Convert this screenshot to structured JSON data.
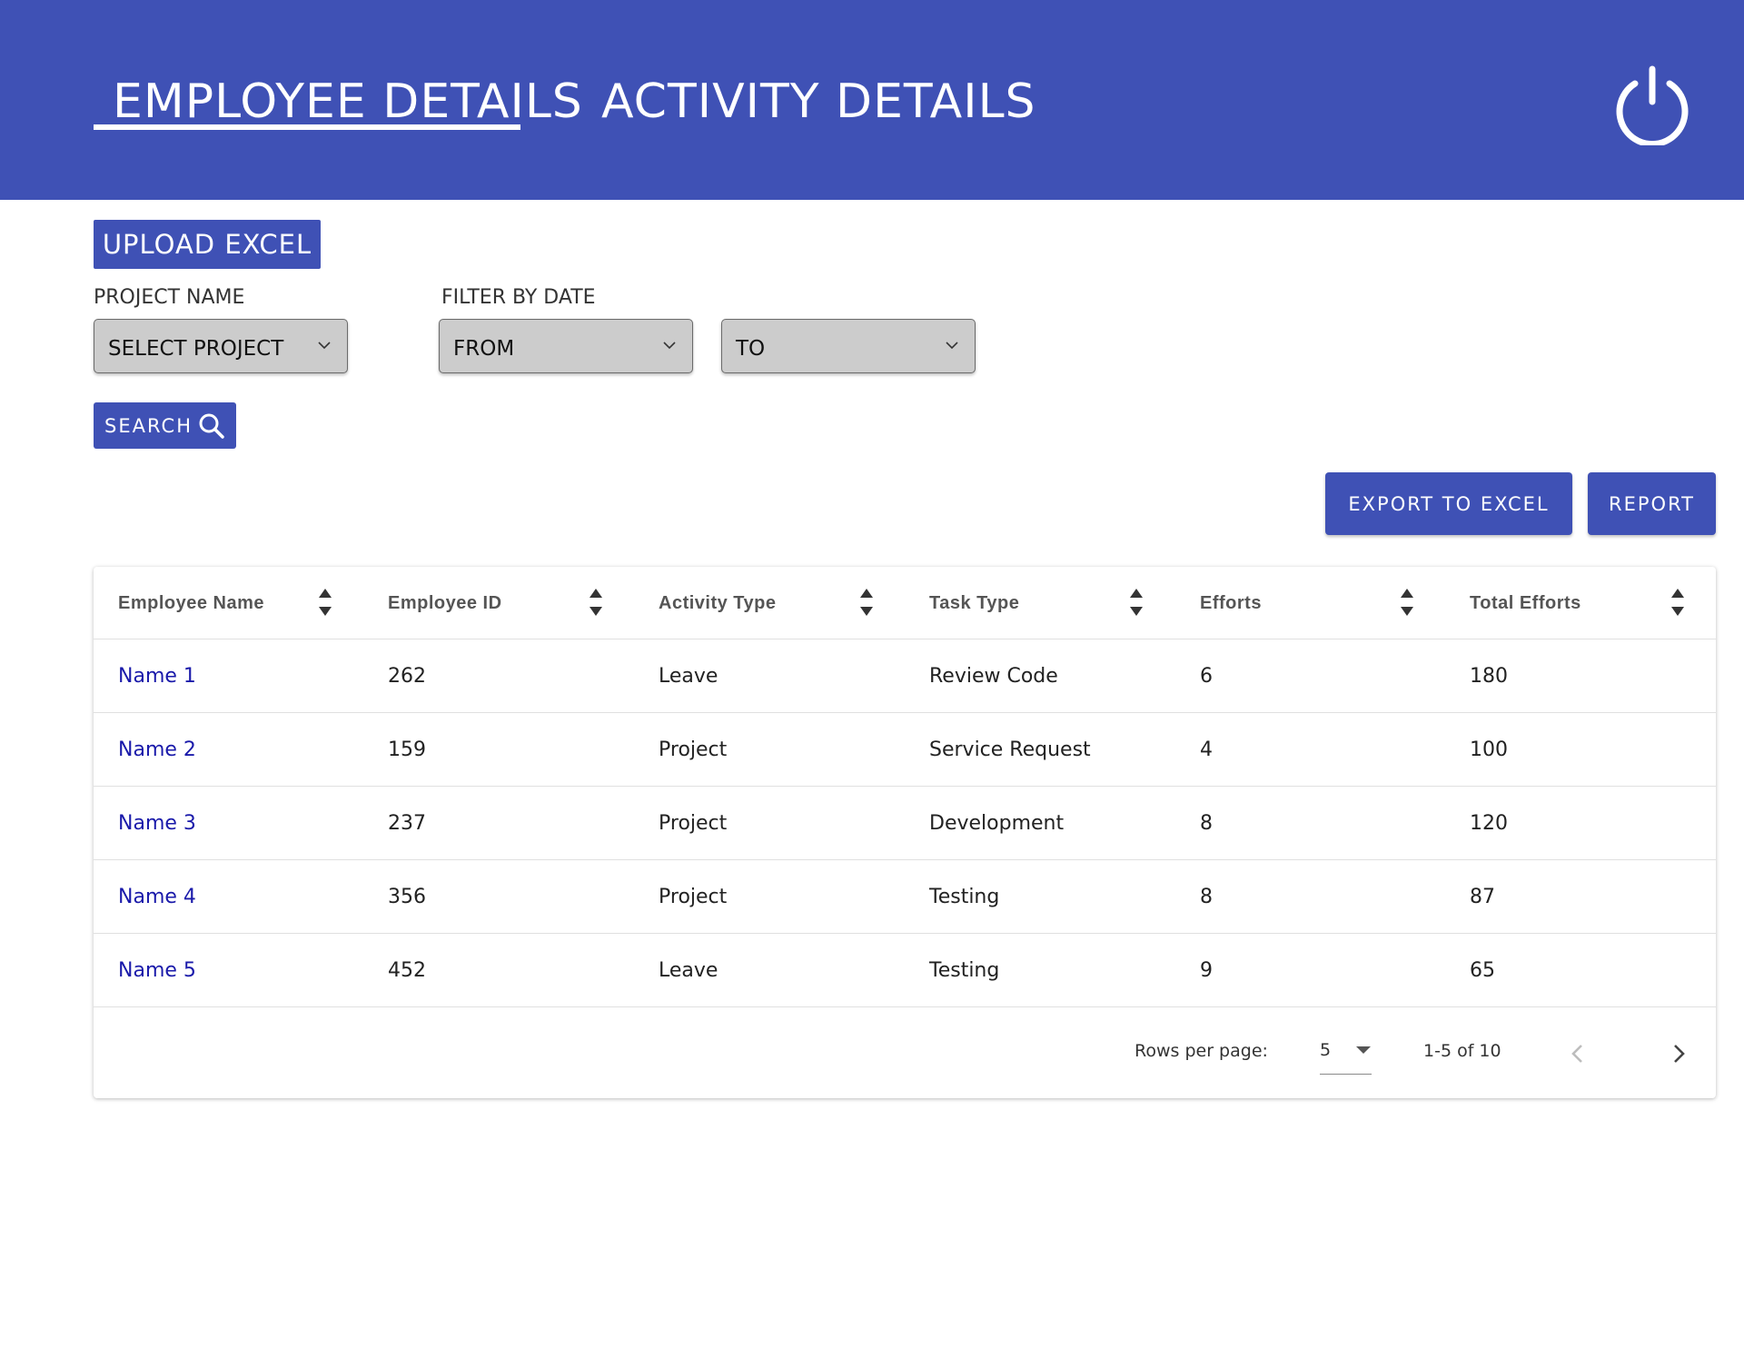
{
  "nav": {
    "tabs": [
      {
        "label": "EMPLOYEE DETAILS"
      },
      {
        "label": "ACTIVITY DETAILS"
      }
    ],
    "power_icon": "power-icon"
  },
  "toolbar": {
    "upload_label": "UPLOAD EXCEL",
    "search_label": "SEARCH",
    "export_label": "EXPORT TO EXCEL",
    "report_label": "REPORT"
  },
  "filters": {
    "project_label": "PROJECT NAME",
    "project_value": "SELECT PROJECT",
    "date_label": "FILTER BY DATE",
    "from_value": "FROM",
    "to_value": "TO"
  },
  "table": {
    "columns": [
      "Employee Name",
      "Employee ID",
      "Activity Type",
      "Task Type",
      "Efforts",
      "Total Efforts"
    ],
    "rows": [
      [
        "Name 1",
        "262",
        "Leave",
        "Review Code",
        "6",
        "180"
      ],
      [
        "Name 2",
        "159",
        "Project",
        "Service Request",
        "4",
        "100"
      ],
      [
        "Name 3",
        "237",
        "Project",
        "Development",
        "8",
        "120"
      ],
      [
        "Name 4",
        "356",
        "Project",
        "Testing",
        "8",
        "87"
      ],
      [
        "Name 5",
        "452",
        "Leave",
        "Testing",
        "9",
        "65"
      ]
    ]
  },
  "pagination": {
    "rows_per_page_label": "Rows per page:",
    "rows_per_page_value": "5",
    "range_text": "1-5 of 10"
  },
  "colors": {
    "primary": "#3f51b5",
    "link": "#1a1aaa",
    "select_bg": "#cccccc"
  }
}
